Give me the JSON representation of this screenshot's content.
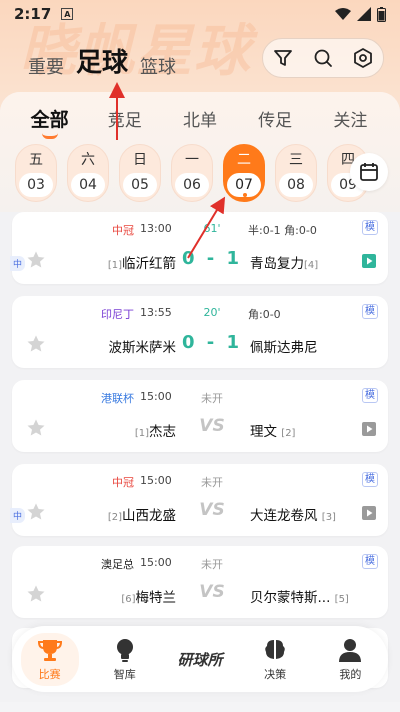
{
  "status_bar": {
    "time": "2:17",
    "indicator": "A"
  },
  "watermark": "晓帆星球",
  "top_tabs": [
    {
      "label": "重要",
      "active": false
    },
    {
      "label": "足球",
      "active": true
    },
    {
      "label": "篮球",
      "active": false
    }
  ],
  "tools": [
    "filter-icon",
    "search-icon",
    "settings-icon"
  ],
  "sub_tabs": [
    {
      "label": "全部",
      "active": true
    },
    {
      "label": "竞足",
      "active": false
    },
    {
      "label": "北单",
      "active": false
    },
    {
      "label": "传足",
      "active": false
    },
    {
      "label": "关注",
      "active": false
    }
  ],
  "dates": [
    {
      "weekday": "五",
      "day": "03",
      "active": false
    },
    {
      "weekday": "六",
      "day": "04",
      "active": false
    },
    {
      "weekday": "日",
      "day": "05",
      "active": false
    },
    {
      "weekday": "一",
      "day": "06",
      "active": false
    },
    {
      "weekday": "二",
      "day": "07",
      "active": true
    },
    {
      "weekday": "三",
      "day": "08",
      "active": false
    },
    {
      "weekday": "四",
      "day": "09",
      "active": false
    }
  ],
  "matches": [
    {
      "league": "中冠",
      "league_color": "#e8453c",
      "time": "13:00",
      "minute": "61'",
      "odds": "半:0-1  角:0-0",
      "mo": "模",
      "mid_badge": "中",
      "home": "临沂红箭",
      "home_rank": "[1]",
      "away": "青岛复力",
      "away_rank": "[4]",
      "score": "0 - 1",
      "is_live": true,
      "video": "green"
    },
    {
      "league": "印尼丁",
      "league_color": "#7a3fd4",
      "time": "13:55",
      "minute": "20'",
      "odds": "角:0-0",
      "mo": "模",
      "mid_badge": "",
      "home": "波斯米萨米",
      "home_rank": "",
      "away": "佩斯达弗尼",
      "away_rank": "",
      "score": "0 - 1",
      "is_live": true,
      "video": ""
    },
    {
      "league": "港联杯",
      "league_color": "#3a7be0",
      "time": "15:00",
      "minute": "未开",
      "odds": "",
      "mo": "模",
      "mid_badge": "",
      "home": "杰志",
      "home_rank": "[1]",
      "away": "理文",
      "away_rank": "[2]",
      "score": "VS",
      "is_live": false,
      "video": "gray"
    },
    {
      "league": "中冠",
      "league_color": "#e8453c",
      "time": "15:00",
      "minute": "未开",
      "odds": "",
      "mo": "模",
      "mid_badge": "中",
      "home": "山西龙盛",
      "home_rank": "[2]",
      "away": "大连龙卷风",
      "away_rank": "[3]",
      "score": "VS",
      "is_live": false,
      "video": "gray"
    },
    {
      "league": "澳足总",
      "league_color": "#222222",
      "time": "15:00",
      "minute": "未开",
      "odds": "",
      "mo": "模",
      "mid_badge": "",
      "home": "梅特兰",
      "home_rank": "[6]",
      "away": "贝尔蒙特斯...",
      "away_rank": "[5]",
      "score": "VS",
      "is_live": false,
      "video": ""
    }
  ],
  "bottom_nav": [
    {
      "label": "比赛",
      "icon": "trophy-icon",
      "active": true
    },
    {
      "label": "智库",
      "icon": "bulb-icon",
      "active": false
    },
    {
      "label": "研球所",
      "icon": "lab-icon",
      "active": false,
      "center": true
    },
    {
      "label": "决策",
      "icon": "brain-icon",
      "active": false
    },
    {
      "label": "我的",
      "icon": "user-icon",
      "active": false
    }
  ],
  "colors": {
    "accent": "#ff7a1a",
    "score_green": "#2fb59b",
    "arrow_red": "#e0302a"
  }
}
